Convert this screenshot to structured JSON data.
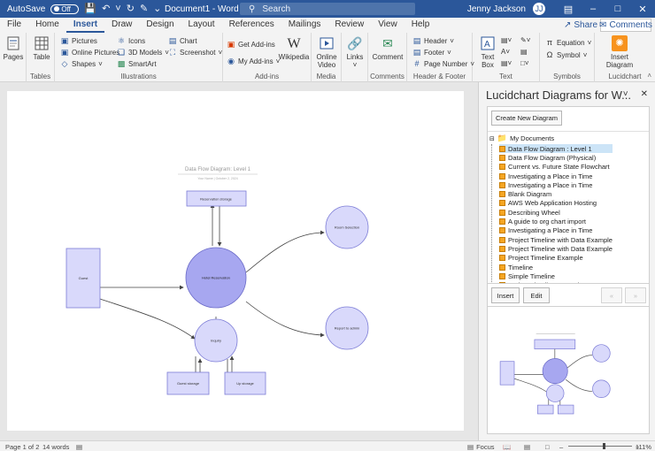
{
  "titlebar": {
    "autosave_label": "AutoSave",
    "autosave_state": "Off",
    "document_title": "Document1 - Word",
    "search_placeholder": "Search",
    "user_name": "Jenny Jackson",
    "user_initials": "JJ"
  },
  "tabs": [
    "File",
    "Home",
    "Insert",
    "Draw",
    "Design",
    "Layout",
    "References",
    "Mailings",
    "Review",
    "View",
    "Help"
  ],
  "active_tab": "Insert",
  "share_label": "Share",
  "comments_label": "Comments",
  "ribbon": {
    "pages": {
      "button": "Pages",
      "label": ""
    },
    "tables": {
      "button": "Table",
      "label": "Tables"
    },
    "illustrations": {
      "pictures": "Pictures",
      "online_pictures": "Online Pictures",
      "shapes": "Shapes",
      "icons": "Icons",
      "models": "3D Models",
      "smartart": "SmartArt",
      "chart": "Chart",
      "screenshot": "Screenshot",
      "label": "Illustrations"
    },
    "addins": {
      "get": "Get Add-ins",
      "my": "My Add-ins",
      "wikipedia": "Wikipedia",
      "label": "Add-ins"
    },
    "media": {
      "online_video_1": "Online",
      "online_video_2": "Video",
      "label": "Media"
    },
    "links": {
      "button": "Links"
    },
    "comments": {
      "button": "Comment",
      "label": "Comments"
    },
    "header_footer": {
      "header": "Header",
      "footer": "Footer",
      "page_number": "Page Number",
      "label": "Header & Footer"
    },
    "text": {
      "textbox_1": "Text",
      "textbox_2": "Box",
      "label": "Text"
    },
    "symbols": {
      "equation": "Equation",
      "symbol": "Symbol",
      "label": "Symbols"
    },
    "lucidchart": {
      "insert_1": "Insert",
      "insert_2": "Diagram",
      "label": "Lucidchart"
    }
  },
  "diagram": {
    "title": "Data Flow Diagram: Level 1",
    "subtitle": "Your Name | October 2, 2024",
    "reservation_storage": "Reservation storage",
    "room_selection": "Room Selection",
    "guest": "Guest",
    "hotel_reservation": "Hotel Reservation",
    "report_to_admin": "Report to admin",
    "inquiry": "Inquiry",
    "guest_storage": "Guest storage",
    "up_storage": "Up storage"
  },
  "pane": {
    "title": "Lucidchart Diagrams for W...",
    "create_button": "Create New Diagram",
    "root_folder": "My Documents",
    "documents": [
      "Data Flow Diagram : Level 1",
      "Data Flow Diagram (Physical)",
      "Current vs. Future State Flowchart",
      "Investigating a Place in Time",
      "Investigating a Place in Time",
      "Blank Diagram",
      "AWS Web Application Hosting",
      "Describing Wheel",
      "A guide to org chart import",
      "Investigating a Place in Time",
      "Project Timeline with Data Example",
      "Project Timeline with Data Example",
      "Project Timeline Example",
      "Timeline",
      "Simple Timeline",
      "Project Timeline Example"
    ],
    "selected_index": 0,
    "insert_button": "Insert",
    "edit_button": "Edit",
    "prev_button": "«",
    "next_button": "»"
  },
  "status": {
    "page": "Page 1 of 2",
    "words": "14 words",
    "focus": "Focus",
    "zoom": "111%",
    "zoom_level": 0.55
  },
  "colors": {
    "word_blue": "#2b579a",
    "lucid_orange": "#f7931e",
    "node_fill": "#d9d9fb",
    "node_fill_dark": "#a7a7f0",
    "node_stroke": "#7b7bd6",
    "selection": "#cce4f7"
  }
}
